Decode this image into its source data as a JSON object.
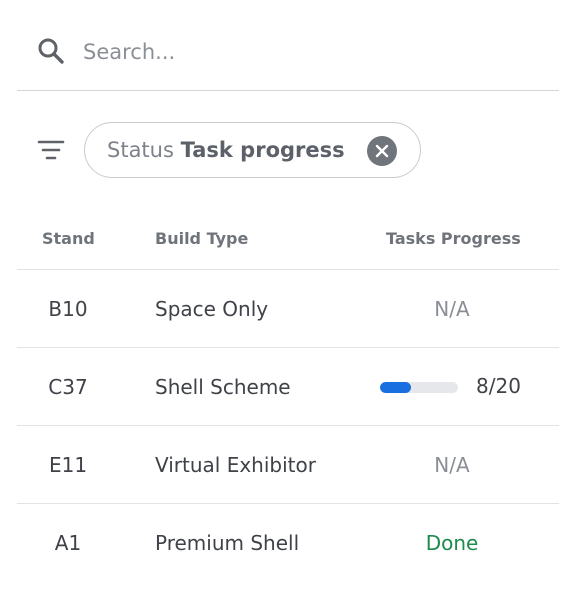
{
  "search": {
    "placeholder": "Search...",
    "value": "",
    "icon": "search-icon"
  },
  "filter": {
    "icon": "filter-icon",
    "chip": {
      "key": "Status",
      "value": "Task progress",
      "clear_icon": "close-circle-icon"
    }
  },
  "table": {
    "columns": {
      "stand": "Stand",
      "build_type": "Build Type",
      "tasks_progress": "Tasks Progress"
    },
    "rows": [
      {
        "stand": "B10",
        "build_type": "Space Only",
        "progress_text": "N/A",
        "progress_kind": "na"
      },
      {
        "stand": "C37",
        "build_type": "Shell Scheme",
        "progress_text": "8/20",
        "progress_kind": "bar",
        "progress_fraction": 0.4
      },
      {
        "stand": "E11",
        "build_type": "Virtual Exhibitor",
        "progress_text": "N/A",
        "progress_kind": "na"
      },
      {
        "stand": "A1",
        "build_type": "Premium Shell",
        "progress_text": "Done",
        "progress_kind": "done"
      }
    ]
  },
  "colors": {
    "accent": "#1a6fe0",
    "done": "#1e8a4c",
    "track": "#e6e7ea"
  }
}
